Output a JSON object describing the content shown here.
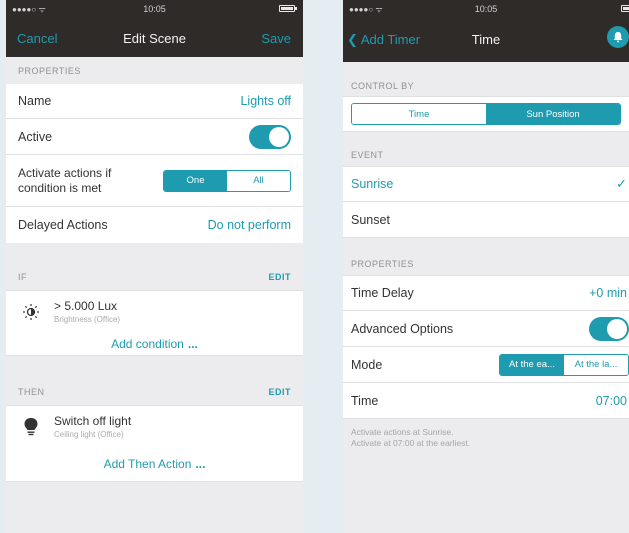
{
  "left_screen": {
    "status": {
      "signal": "●●●●○ ᯤ",
      "time": "10:05"
    },
    "nav": {
      "left": "Cancel",
      "title": "Edit Scene",
      "right": "Save"
    },
    "properties_header": "PROPERTIES",
    "rows": {
      "name_label": "Name",
      "name_value": "Lights off",
      "active_label": "Active",
      "activate_label_line1": "Activate actions if",
      "activate_label_line2": "condition is met",
      "seg_one": "One",
      "seg_all": "All",
      "delayed_label": "Delayed Actions",
      "delayed_value": "Do not perform"
    },
    "if_section": {
      "header": "IF",
      "edit": "EDIT"
    },
    "condition": {
      "title": "> 5.000 Lux",
      "subtitle": "Brightness (Office)"
    },
    "add_condition": {
      "label": "Add condition",
      "dots": "..."
    },
    "then_section": {
      "header": "THEN",
      "edit": "EDIT"
    },
    "action": {
      "title": "Switch off light",
      "subtitle": "Ceiling light (Office)"
    },
    "add_action": {
      "label": "Add Then Action",
      "dots": "..."
    }
  },
  "right_screen": {
    "status": {
      "signal": "●●●●○ ᯤ",
      "time": "10:05"
    },
    "nav": {
      "back": "Add Timer",
      "title": "Time"
    },
    "control_header": "CONTROL BY",
    "control_seg": {
      "time": "Time",
      "sun": "Sun Position"
    },
    "event_header": "EVENT",
    "event_rows": {
      "sunrise": "Sunrise",
      "check": "✓",
      "sunset": "Sunset"
    },
    "properties_header": "PROPERTIES",
    "rows": {
      "delay_label": "Time Delay",
      "delay_value": "+0 min",
      "advanced_label": "Advanced Options",
      "mode_label": "Mode",
      "mode_opt1": "At the ea...",
      "mode_opt2": "At the la...",
      "time_label": "Time",
      "time_value": "07:00"
    },
    "note": {
      "line1": "Activate actions at Sunrise.",
      "line2": "Activate at 07:00 at the earliest."
    }
  },
  "colors": {
    "accent": "#1f9bb0",
    "navbar": "#2e2b28",
    "background": "#ececee"
  }
}
